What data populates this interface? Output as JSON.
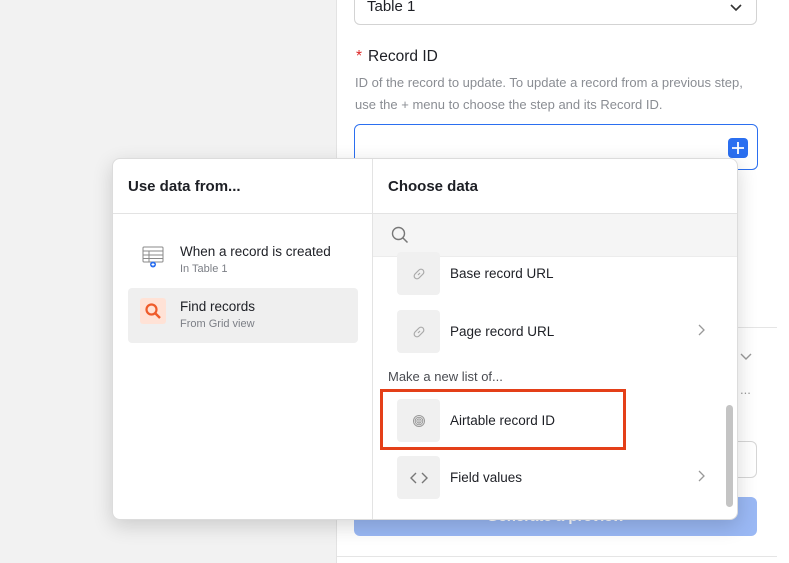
{
  "form": {
    "table_select_value": "Table 1",
    "record_id_label": "Record ID",
    "required_marker": "*",
    "record_id_help": "ID of the record to update. To update a record from a previous step, use the + menu to choose the step and its Record ID.",
    "generate_button": "Generate a preview",
    "faint_dots": "..."
  },
  "popup": {
    "left_header": "Use data from...",
    "right_header": "Choose data",
    "search_placeholder": "",
    "sources": [
      {
        "title": "When a record is created",
        "subtitle": "In Table 1",
        "icon": "table-icon"
      },
      {
        "title": "Find records",
        "subtitle": "From Grid view",
        "icon": "search-icon"
      }
    ],
    "items_top": [
      {
        "label": "Base record URL",
        "icon": "link-icon"
      },
      {
        "label": "Page record URL",
        "icon": "link-icon"
      }
    ],
    "list_section_title": "Make a new list of...",
    "items_list": [
      {
        "label": "Airtable record ID",
        "icon": "fingerprint-icon"
      },
      {
        "label": "Field values",
        "icon": "code-icon"
      }
    ]
  },
  "colors": {
    "accent": "#2b6ff0",
    "highlight": "#e43f18",
    "required": "#dc2626",
    "find_icon": "#ef5b2a"
  }
}
